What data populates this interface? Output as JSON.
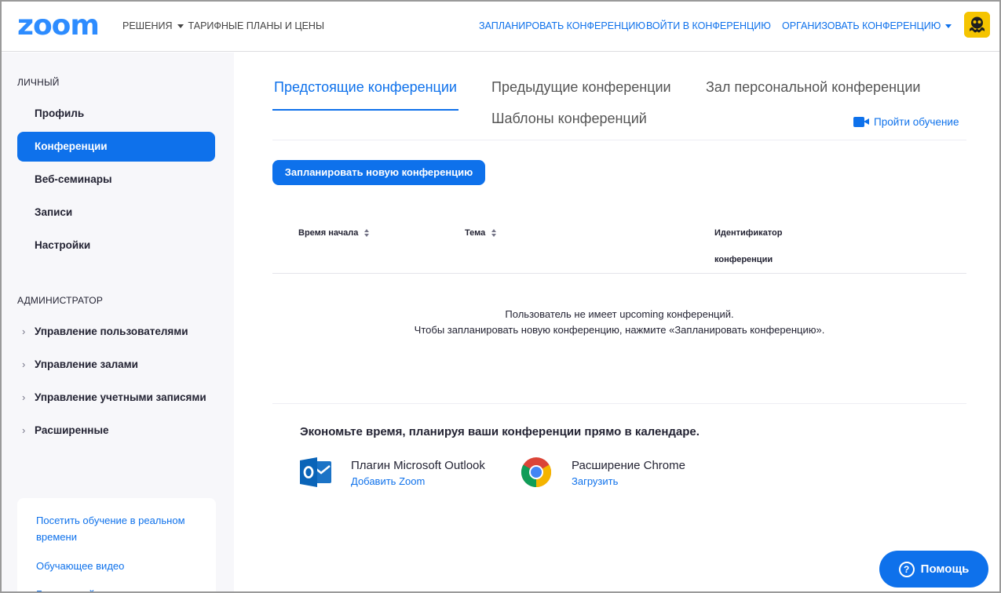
{
  "header": {
    "logo": "zoom",
    "nav_solutions": "РЕШЕНИЯ",
    "nav_plans": "ТАРИФНЫЕ ПЛАНЫ И ЦЕНЫ",
    "nav_schedule": "ЗАПЛАНИРОВАТЬ КОНФЕРЕНЦИЮ",
    "nav_join": "ВОЙТИ В КОНФЕРЕНЦИЮ",
    "nav_host": "ОРГАНИЗОВАТЬ КОНФЕРЕНЦИЮ"
  },
  "sidebar": {
    "personal_heading": "ЛИЧНЫЙ",
    "personal_items": [
      "Профиль",
      "Конференции",
      "Веб-семинары",
      "Записи",
      "Настройки"
    ],
    "active_item": "Конференции",
    "admin_heading": "АДМИНИСТРАТОР",
    "admin_items": [
      "Управление пользователями",
      "Управление залами",
      "Управление учетными записями",
      "Расширенные"
    ],
    "help_links": [
      "Посетить обучение в реальном времени",
      "Обучающее видео",
      "База знаний"
    ]
  },
  "tabs": {
    "upcoming": "Предстоящие конференции",
    "previous": "Предыдущие конференции",
    "personal_room": "Зал персональной конференции",
    "templates": "Шаблоны конференций"
  },
  "training_link": "Пройти обучение",
  "schedule_button": "Запланировать новую конференцию",
  "table": {
    "col_start": "Время начала",
    "col_topic": "Тема",
    "col_id_line1": "Идентификатор",
    "col_id_line2": "конференции"
  },
  "empty_state": {
    "line1": "Пользователь не имеет upcoming конференций.",
    "line2": "Чтобы запланировать новую конференцию, нажмите «Запланировать конференцию»."
  },
  "promo": {
    "title": "Экономьте время, планируя ваши конференции прямо в календаре.",
    "outlook_name": "Плагин Microsoft Outlook",
    "outlook_link": "Добавить Zoom",
    "chrome_name": "Расширение Chrome",
    "chrome_link": "Загрузить"
  },
  "help_button": "Помощь",
  "colors": {
    "accent": "#0e71eb",
    "logo": "#2d8cff",
    "sidebar_bg": "#f7f7fa"
  }
}
